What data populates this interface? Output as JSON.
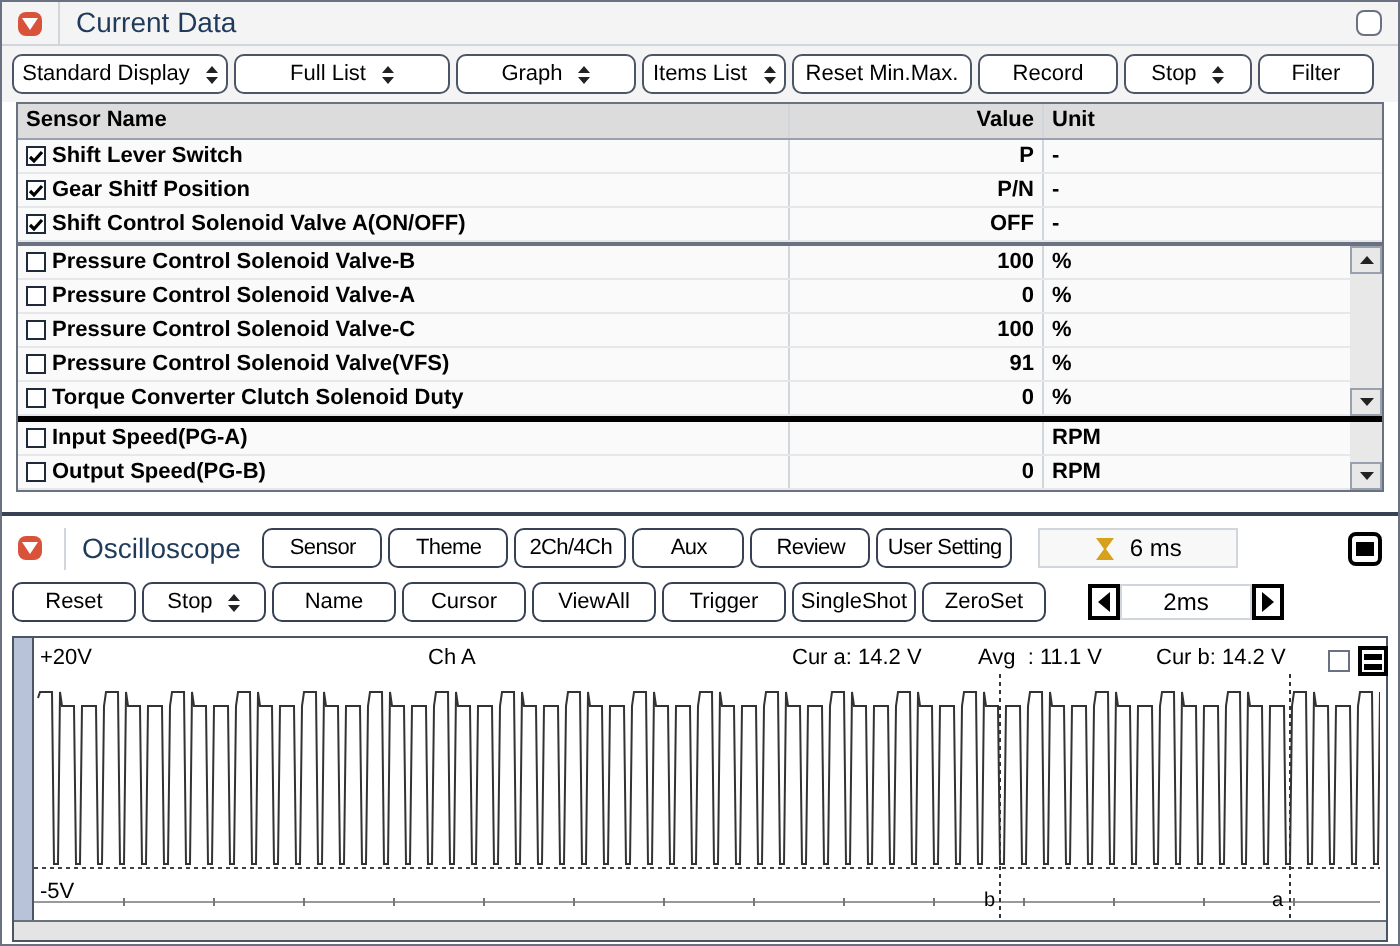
{
  "current_data": {
    "title": "Current Data",
    "toolbar": [
      {
        "label": "Standard Display",
        "dropdown": true
      },
      {
        "label": "Full List",
        "dropdown": true
      },
      {
        "label": "Graph",
        "dropdown": true
      },
      {
        "label": "Items List",
        "dropdown": true
      },
      {
        "label": "Reset Min.Max.",
        "dropdown": false
      },
      {
        "label": "Record",
        "dropdown": false
      },
      {
        "label": "Stop",
        "dropdown": true
      },
      {
        "label": "Filter",
        "dropdown": false
      }
    ],
    "columns": [
      "Sensor Name",
      "Value",
      "Unit"
    ],
    "fixed_rows": [
      {
        "name": "Shift Lever Switch",
        "value": "P",
        "unit": "-",
        "checked": true
      },
      {
        "name": "Gear Shitf Position",
        "value": "P/N",
        "unit": "-",
        "checked": true
      },
      {
        "name": "Shift Control Solenoid Valve A(ON/OFF)",
        "value": "OFF",
        "unit": "-",
        "checked": true
      }
    ],
    "rows": [
      {
        "name": "Pressure Control Solenoid Valve-B",
        "value": "100",
        "unit": "%",
        "checked": false
      },
      {
        "name": "Pressure Control Solenoid Valve-A",
        "value": "0",
        "unit": "%",
        "checked": false
      },
      {
        "name": "Pressure Control Solenoid Valve-C",
        "value": "100",
        "unit": "%",
        "checked": false
      },
      {
        "name": "Pressure Control Solenoid Valve(VFS)",
        "value": "91",
        "unit": "%",
        "checked": false
      },
      {
        "name": "Torque Converter Clutch Solenoid Duty",
        "value": "0",
        "unit": "%",
        "checked": false
      }
    ],
    "lower_rows": [
      {
        "name": "Input Speed(PG-A)",
        "unit": "RPM",
        "checked": false
      },
      {
        "name": "Output Speed(PG-B)",
        "value": "0",
        "unit": "RPM",
        "checked": false
      }
    ]
  },
  "oscilloscope": {
    "title": "Oscilloscope",
    "top_buttons": [
      "Sensor",
      "Theme",
      "2Ch/4Ch",
      "Aux",
      "Review",
      "User Setting"
    ],
    "sample_time": "6 ms",
    "buttons": [
      {
        "label": "Reset",
        "dropdown": false
      },
      {
        "label": "Stop",
        "dropdown": true
      },
      {
        "label": "Name",
        "dropdown": false
      },
      {
        "label": "Cursor",
        "dropdown": false
      },
      {
        "label": "ViewAll",
        "dropdown": false
      },
      {
        "label": "Trigger",
        "dropdown": false
      },
      {
        "label": "SingleShot",
        "dropdown": false
      },
      {
        "label": "ZeroSet",
        "dropdown": false
      }
    ],
    "time_div": "2ms",
    "scope": {
      "overlay_checked": false,
      "top_label": "+20V",
      "bottom_label": "-5V",
      "channel": "Ch A",
      "cur_a": "Cur a: 14.2 V",
      "avg": "Avg  : 11.1 V",
      "cur_b": "Cur b: 14.2 V",
      "cursor_b": "b",
      "cursor_a": "a"
    }
  }
}
